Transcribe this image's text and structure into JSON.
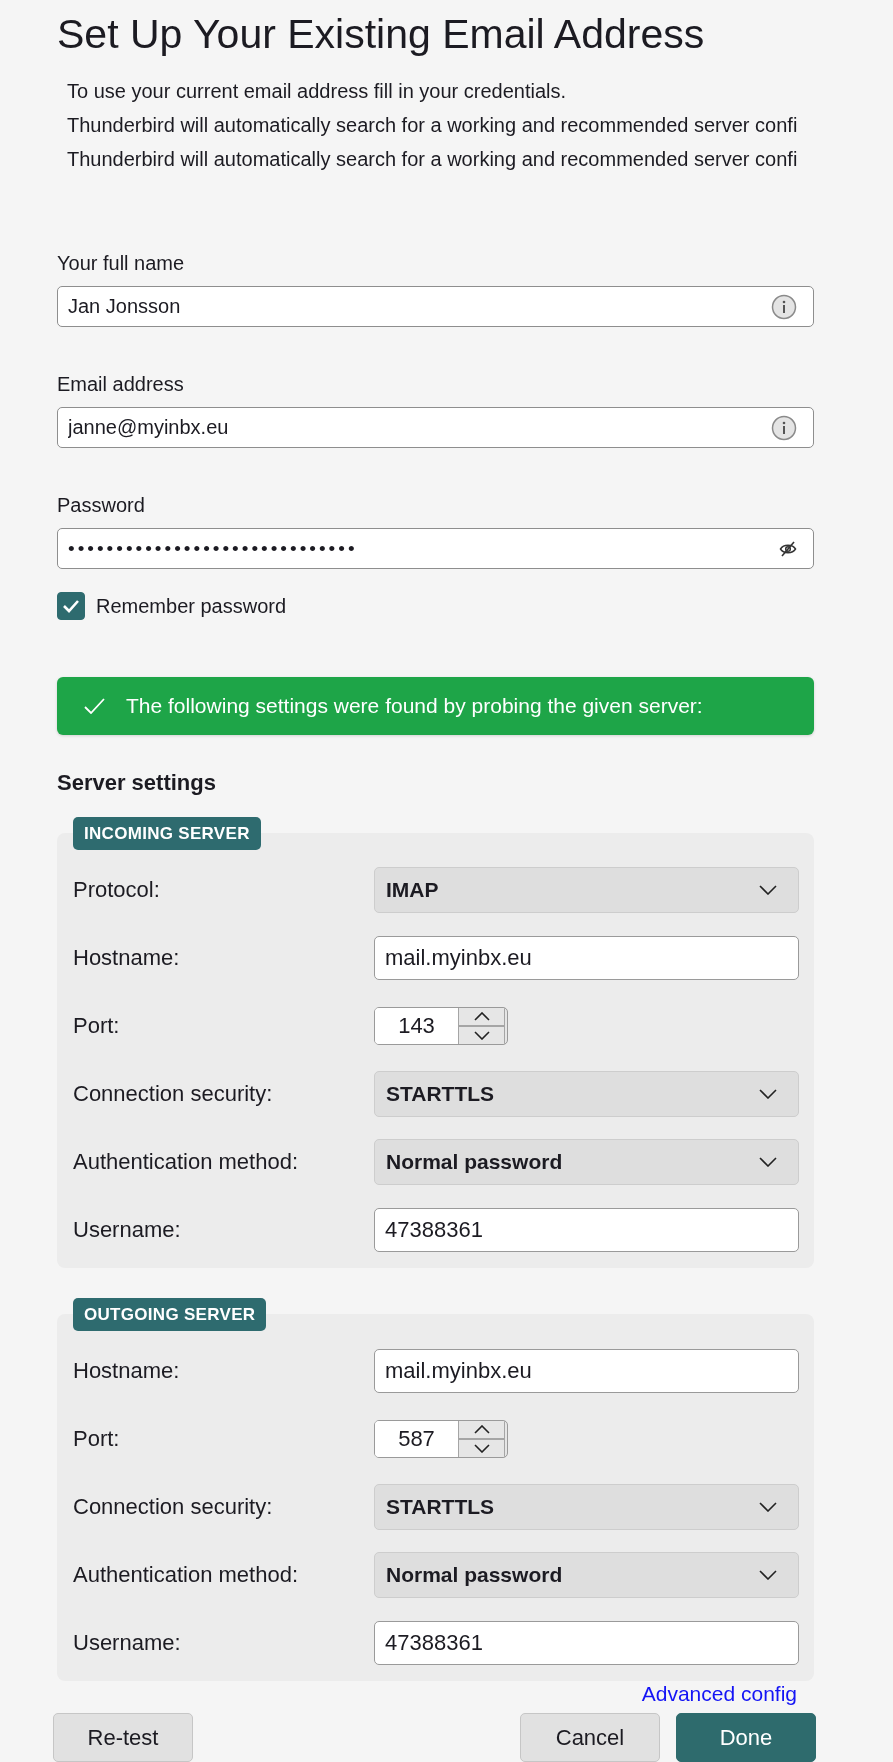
{
  "page": {
    "title": "Set Up Your Existing Email Address",
    "intro": [
      "To use your current email address fill in your credentials.",
      "Thunderbird will automatically search for a working and recommended server confi",
      "Thunderbird will automatically search for a working and recommended server confi"
    ]
  },
  "account": {
    "fields": [
      {
        "kind": "text",
        "label": "Your full name",
        "value": "Jan Jonsson"
      },
      {
        "kind": "text",
        "label": "Email address",
        "value": "janne@myinbx.eu"
      },
      {
        "kind": "password",
        "label": "Password",
        "value": "••••••••••••••••••••••••••••••"
      }
    ],
    "remember_password": {
      "label": "Remember password",
      "checked": true
    }
  },
  "status_banner": {
    "kind": "success",
    "text": "The following settings were found by probing the given server:"
  },
  "server_settings": {
    "heading": "Server settings",
    "sections": [
      {
        "title": "INCOMING SERVER",
        "rows": [
          {
            "kind": "select",
            "label": "Protocol:",
            "value": "IMAP"
          },
          {
            "kind": "text",
            "label": "Hostname:",
            "value": "mail.myinbx.eu"
          },
          {
            "kind": "number",
            "label": "Port:",
            "value": "143"
          },
          {
            "kind": "select",
            "label": "Connection security:",
            "value": "STARTTLS"
          },
          {
            "kind": "select",
            "label": "Authentication method:",
            "value": "Normal password"
          },
          {
            "kind": "text",
            "label": "Username:",
            "value": "47388361"
          }
        ]
      },
      {
        "title": "OUTGOING SERVER",
        "rows": [
          {
            "kind": "text",
            "label": "Hostname:",
            "value": "mail.myinbx.eu"
          },
          {
            "kind": "number",
            "label": "Port:",
            "value": "587"
          },
          {
            "kind": "select",
            "label": "Connection security:",
            "value": "STARTTLS"
          },
          {
            "kind": "select",
            "label": "Authentication method:",
            "value": "Normal password"
          },
          {
            "kind": "text",
            "label": "Username:",
            "value": "47388361"
          }
        ]
      }
    ]
  },
  "advanced_link": "Advanced config",
  "footer": {
    "left_buttons": [
      {
        "label": "Re-test",
        "kind": "secondary"
      }
    ],
    "right_buttons": [
      {
        "label": "Cancel",
        "kind": "secondary"
      },
      {
        "label": "Done",
        "kind": "primary"
      }
    ]
  }
}
